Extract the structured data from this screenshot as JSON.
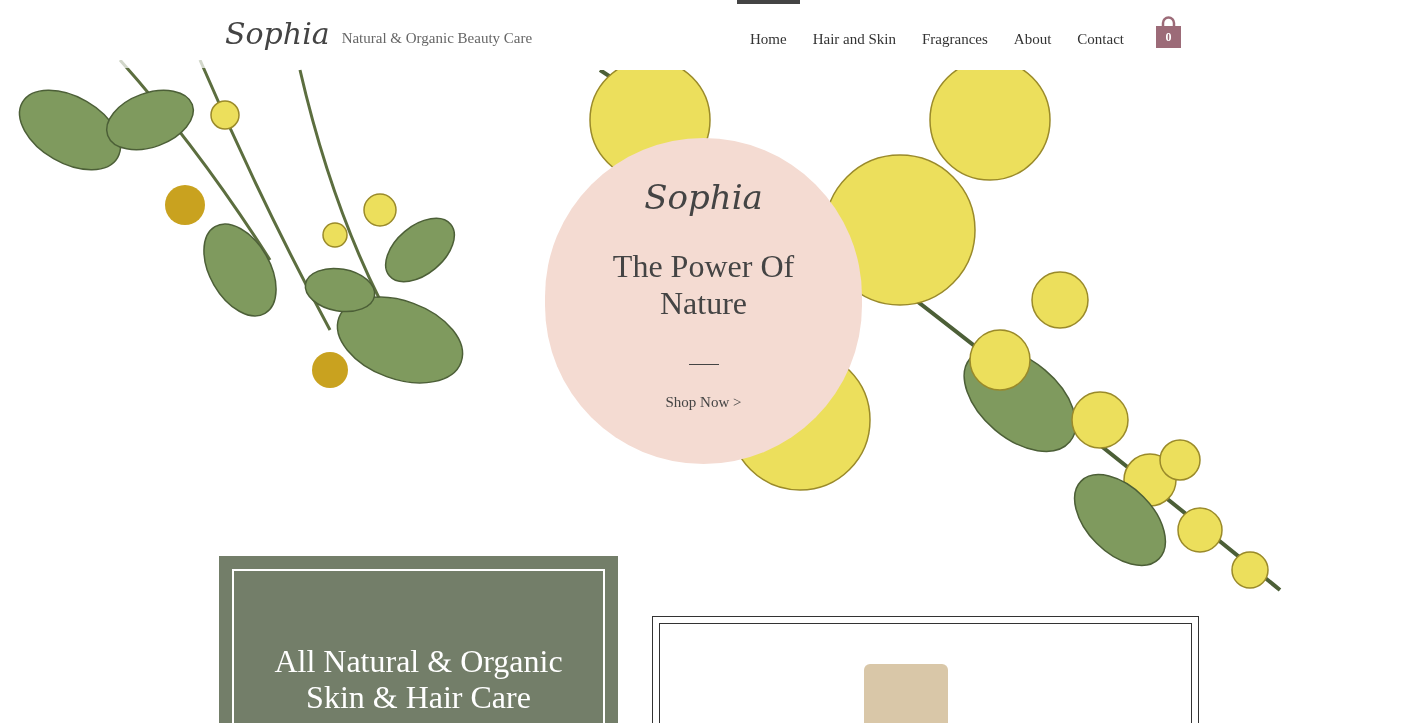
{
  "header": {
    "logo": "Sophia",
    "tagline": "Natural & Organic Beauty Care",
    "nav": [
      {
        "label": "Home",
        "selected": true
      },
      {
        "label": "Hair and Skin",
        "selected": false
      },
      {
        "label": "Fragrances",
        "selected": false
      },
      {
        "label": "About",
        "selected": false
      },
      {
        "label": "Contact",
        "selected": false
      }
    ],
    "cart_count": "0"
  },
  "hero": {
    "logo": "Sophia",
    "title": "The Power Of Nature",
    "link": "Shop Now >"
  },
  "feature": {
    "heading": "All Natural & Organic Skin & Hair Care"
  }
}
